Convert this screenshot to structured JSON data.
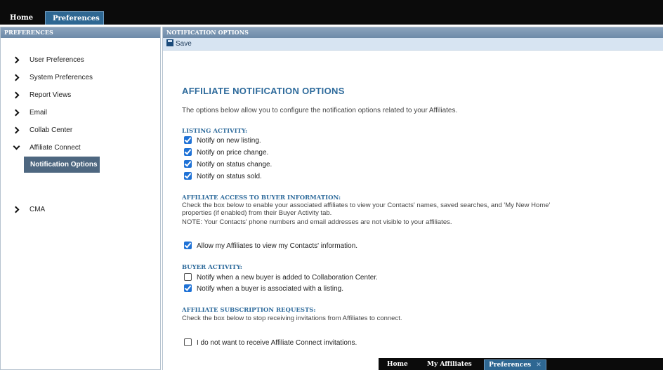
{
  "top_tabs": {
    "home": "Home",
    "preferences": "Preferences",
    "close": "✕"
  },
  "left_panel": {
    "header": "PREFERENCES",
    "items": [
      {
        "label": "User Preferences",
        "expanded": false
      },
      {
        "label": "System Preferences",
        "expanded": false
      },
      {
        "label": "Report Views",
        "expanded": false
      },
      {
        "label": "Email",
        "expanded": false
      },
      {
        "label": "Collab Center",
        "expanded": false
      },
      {
        "label": "Affiliate Connect",
        "expanded": true
      },
      {
        "label": "CMA",
        "expanded": false
      }
    ],
    "sub_item": "Notification Options"
  },
  "right_panel": {
    "header": "NOTIFICATION OPTIONS",
    "save_label": "Save"
  },
  "content": {
    "title": "AFFILIATE NOTIFICATION OPTIONS",
    "intro": "The options below allow you to configure the notification options related to your Affiliates.",
    "listing": {
      "heading": "LISTING ACTIVITY:",
      "options": [
        {
          "label": "Notify on new listing.",
          "checked": true
        },
        {
          "label": "Notify on price change.",
          "checked": true
        },
        {
          "label": "Notify on status change.",
          "checked": true
        },
        {
          "label": "Notify on status sold.",
          "checked": true
        }
      ]
    },
    "access": {
      "heading": "AFFILIATE ACCESS TO BUYER INFORMATION:",
      "line1": "Check the box below to enable your associated affiliates to view your Contacts' names, saved searches, and 'My New Home'",
      "line2": "properties (if enabled) from their Buyer Activity tab.",
      "line3": "NOTE: Your Contacts' phone numbers and email addresses are not visible to your affiliates.",
      "option": {
        "label": "Allow my Affiliates to view my Contacts' information.",
        "checked": true
      }
    },
    "buyer": {
      "heading": "BUYER ACTIVITY:",
      "options": [
        {
          "label": "Notify when a new buyer is added to Collaboration Center.",
          "checked": false
        },
        {
          "label": "Notify when a buyer is associated with a listing.",
          "checked": true
        }
      ]
    },
    "subscription": {
      "heading": "AFFILIATE SUBSCRIPTION REQUESTS:",
      "desc": "Check the box below to stop receiving invitations from Affiliates to connect.",
      "option": {
        "label": "I do not want to receive Affiliate Connect invitations.",
        "checked": false
      }
    }
  },
  "bottom_tabs": [
    "Home",
    "My Affiliates",
    "Preferences"
  ],
  "bottom_close": "✕",
  "colors": {
    "accent": "#2d6a9b",
    "checkbox": "#1f72d6",
    "selected_nav": "#4e6780",
    "topbar": "#0b0b0b"
  }
}
